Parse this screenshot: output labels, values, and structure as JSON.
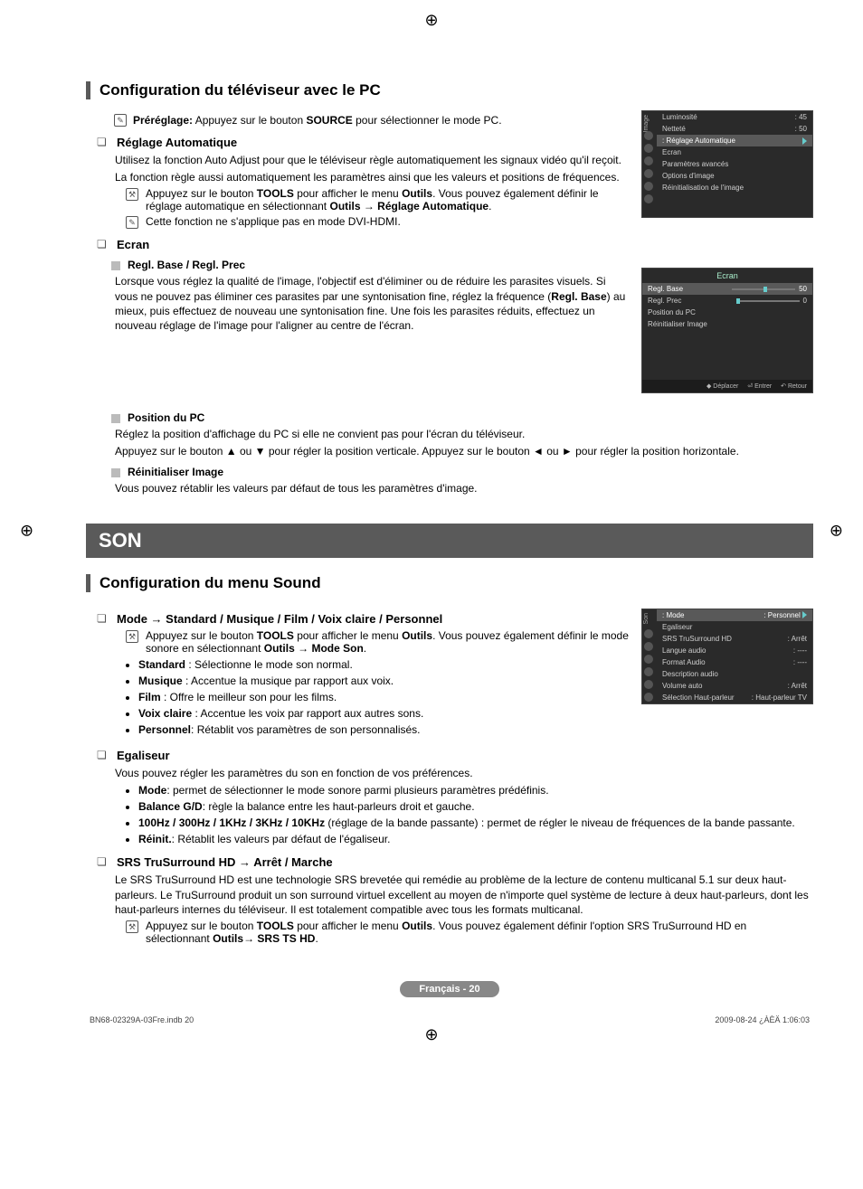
{
  "sec1": {
    "title": "Configuration du téléviseur avec le PC",
    "prereg_bold": "Préréglage:",
    "prereg_rest": " Appuyez sur le bouton ",
    "prereg_src": "SOURCE",
    "prereg_tail": " pour sélectionner le mode PC.",
    "auto": {
      "heading": "Réglage Automatique",
      "p1": "Utilisez la fonction Auto Adjust pour que le téléviseur règle automatiquement les signaux vidéo qu'il reçoit.",
      "p2": "La fonction règle aussi automatiquement les paramètres ainsi que les valeurs et positions de fréquences.",
      "tools1_a": "Appuyez sur le bouton ",
      "tools1_b": "TOOLS",
      "tools1_c": " pour afficher le menu ",
      "tools1_d": "Outils",
      "tools1_e": ". Vous pouvez également définir le réglage automatique en sélectionnant ",
      "tools1_f": "Outils",
      "tools1_g": " → ",
      "tools1_h": "Réglage Automatique",
      "tools1_i": ".",
      "note": "Cette fonction ne s'applique pas en mode DVI-HDMI."
    },
    "ecran": {
      "heading": "Ecran",
      "s1_head": "Regl. Base / Regl. Prec",
      "s1_body": "Lorsque vous réglez la qualité de l'image, l'objectif est d'éliminer ou de réduire les parasites visuels. Si vous ne pouvez pas éliminer ces parasites par une syntonisation fine, réglez la fréquence (",
      "s1_bold": "Regl. Base",
      "s1_tail": ") au mieux, puis effectuez de nouveau une syntonisation fine. Une fois les parasites réduits, effectuez un nouveau réglage de l'image pour l'aligner au centre de l'écran.",
      "s2_head": "Position du PC",
      "s2_p1": "Réglez la position d'affichage du PC si elle ne convient pas pour l'écran du téléviseur.",
      "s2_p2": "Appuyez sur le bouton ▲ ou ▼ pour régler la position verticale. Appuyez sur le bouton ◄ ou ► pour régler la position horizontale.",
      "s3_head": "Réinitialiser Image",
      "s3_p": "Vous pouvez rétablir les valeurs par défaut de tous les paramètres d'image."
    }
  },
  "son_bar": "SON",
  "sec2": {
    "title": "Configuration du menu Sound",
    "mode": {
      "heading": "Mode → Standard / Musique / Film / Voix claire / Personnel",
      "tools_a": "Appuyez sur le bouton ",
      "tools_b": "TOOLS",
      "tools_c": " pour afficher le menu ",
      "tools_d": "Outils",
      "tools_e": ". Vous pouvez également définir le mode sonore en sélectionnant ",
      "tools_f": "Outils",
      "tools_g": " → ",
      "tools_h": "Mode Son",
      "tools_i": ".",
      "li1_b": "Standard",
      "li1_t": " : Sélectionne le mode son normal.",
      "li2_b": "Musique",
      "li2_t": " : Accentue la musique par rapport aux voix.",
      "li3_b": "Film",
      "li3_t": " : Offre le meilleur son pour les films.",
      "li4_b": "Voix claire",
      "li4_t": " : Accentue les voix par rapport aux autres sons.",
      "li5_b": "Personnel",
      "li5_t": ": Rétablit vos paramètres de son personnalisés."
    },
    "eq": {
      "heading": "Egaliseur",
      "p": "Vous pouvez régler les paramètres du son en fonction de vos préférences.",
      "li1_b": "Mode",
      "li1_t": ": permet de sélectionner le mode sonore parmi plusieurs paramètres prédéfinis.",
      "li2_b": "Balance G/D",
      "li2_t": ": règle la balance entre les haut-parleurs droit et gauche.",
      "li3_b": "100Hz / 300Hz / 1KHz / 3KHz / 10KHz",
      "li3_t": " (réglage de la bande passante) : permet de régler le niveau de fréquences de la bande passante.",
      "li4_b": "Réinit.",
      "li4_t": ": Rétablit les valeurs par défaut de l'égaliseur."
    },
    "srs": {
      "heading": "SRS TruSurround HD → Arrêt / Marche",
      "p": "Le SRS TruSurround HD est une technologie SRS brevetée qui remédie au problème de la lecture de contenu multicanal 5.1 sur deux haut-parleurs. Le TruSurround produit un son surround virtuel excellent au moyen de n'importe quel système de lecture à deux haut-parleurs, dont les haut-parleurs internes du téléviseur. Il est totalement compatible avec tous les formats multicanal.",
      "tools_a": "Appuyez sur le bouton ",
      "tools_b": "TOOLS",
      "tools_c": " pour afficher le menu ",
      "tools_d": "Outils",
      "tools_e": ". Vous pouvez également définir l'option SRS TruSurround HD en sélectionnant ",
      "tools_f": "Outils",
      "tools_g": "→ ",
      "tools_h": "SRS TS HD",
      "tools_i": "."
    }
  },
  "osd1": {
    "side": "Image",
    "rows": [
      {
        "l": "Luminosité",
        "r": ": 45"
      },
      {
        "l": "Netteté",
        "r": ": 50"
      }
    ],
    "hi": ": Réglage Automatique",
    "after": [
      "Ecran",
      "Paramètres avancés",
      "Options d'image",
      "Réinitialisation de l'image"
    ]
  },
  "osd2": {
    "title": "Ecran",
    "rows": [
      {
        "l": "Regl. Base",
        "v": "50",
        "hi": true
      },
      {
        "l": "Regl. Prec",
        "v": "0"
      },
      {
        "l": "Position du PC",
        "v": ""
      },
      {
        "l": "Réinitialiser Image",
        "v": ""
      }
    ],
    "footer": [
      "◆ Déplacer",
      "⏎ Entrer",
      "↶ Retour"
    ]
  },
  "osd3": {
    "side": "Son",
    "hi_l": ": Mode",
    "hi_r": ": Personnel",
    "rows": [
      {
        "l": "Egaliseur",
        "r": ""
      },
      {
        "l": "SRS TruSurround HD",
        "r": ": Arrêt"
      },
      {
        "l": "Langue audio",
        "r": ": ----"
      },
      {
        "l": "Format Audio",
        "r": ": ----"
      },
      {
        "l": "Description audio",
        "r": ""
      },
      {
        "l": "Volume auto",
        "r": ": Arrêt"
      },
      {
        "l": "Sélection Haut-parleur",
        "r": ": Haut-parleur TV"
      }
    ]
  },
  "page_label": "Français - 20",
  "footer_left": "BN68-02329A-03Fre.indb   20",
  "footer_right": "2009-08-24   ¿ÀÈÄ 1:06:03"
}
